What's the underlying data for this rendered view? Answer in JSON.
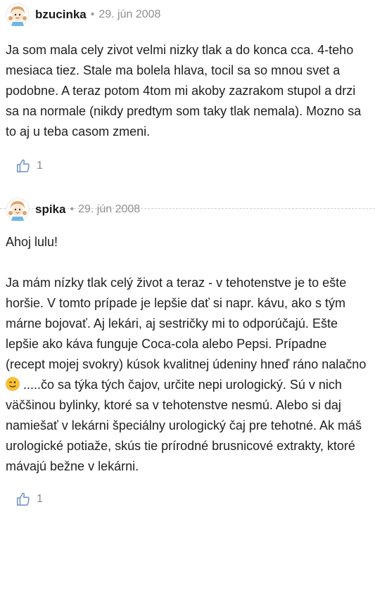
{
  "comments": [
    {
      "username": "bzucinka",
      "separator": "•",
      "date": "29. jún 2008",
      "paragraphs": [
        "Ja som mala cely zivot velmi nizky tlak a do konca cca. 4-teho mesiaca tiez. Stale ma bolela hlava, tocil sa so mnou svet a podobne. A teraz potom 4tom mi akoby zazrakom stupol a drzi sa na normale (nikdy predtym som taky tlak nemala). Mozno sa to aj u teba casom zmeni."
      ],
      "likes": "1"
    },
    {
      "username": "spika",
      "separator": "•",
      "date": "29. jún 2008",
      "paragraphs": [
        "Ahoj lulu!",
        "Ja mám nízky tlak celý život a teraz - v tehotenstve je to ešte horšie. V tomto prípade je lepšie dať si napr. kávu, ako s tým márne bojovať. Aj lekári, aj sestričky mi to odporúčajú. Ešte lepšie ako káva funguje Coca-cola alebo Pepsi. Prípadne (recept mojej svokry) kúsok kvalitnej údeniny hneď ráno nalačno",
        " .....čo sa týka tých čajov, určite nepi urologický. Sú v nich väčšinou bylinky, ktoré sa v tehotenstve nesmú. Alebo si daj namiešať v lekárni špeciálny urologický čaj pre tehotné. Ak máš urologické potiaže, skús tie prírodné brusnicové extrakty, ktoré mávajú bežne v lekárni."
      ],
      "emoji": "winking-face-emoji",
      "likes": "1"
    }
  ],
  "colors": {
    "username": "#1a1a1a",
    "meta": "#8f8f8f",
    "body": "#1f1f1f",
    "divider": "#cfcfcf",
    "like": "#8a8a8a"
  }
}
